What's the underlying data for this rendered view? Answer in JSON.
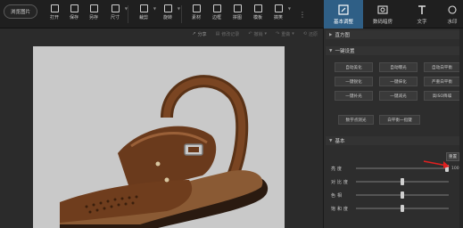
{
  "toolbar": {
    "browse_label": "浏览图片",
    "tools": [
      {
        "label": "打开",
        "icon": "open-icon"
      },
      {
        "label": "保存",
        "icon": "save-icon"
      },
      {
        "label": "另存",
        "icon": "save-as-icon"
      },
      {
        "label": "尺寸",
        "icon": "resize-icon"
      },
      {
        "label": "裁剪",
        "icon": "crop-icon"
      },
      {
        "label": "旋转",
        "icon": "rotate-icon"
      },
      {
        "label": "素材",
        "icon": "material-icon"
      },
      {
        "label": "边框",
        "icon": "border-icon"
      },
      {
        "label": "拼图",
        "icon": "collage-icon"
      },
      {
        "label": "模板",
        "icon": "template-icon"
      },
      {
        "label": "搞笑",
        "icon": "funny-icon"
      }
    ],
    "right_tabs": [
      {
        "label": "基本调整",
        "icon": "adjust-icon"
      },
      {
        "label": "数码暗房",
        "icon": "darkroom-icon"
      },
      {
        "label": "文字",
        "icon": "text-icon"
      },
      {
        "label": "水印",
        "icon": "watermark-icon"
      }
    ]
  },
  "canvas": {
    "sub_toolbar": [
      {
        "label": "分享",
        "icon": "share-icon",
        "dim": false
      },
      {
        "label": "修改记录",
        "icon": "history-icon",
        "dim": true
      },
      {
        "label": "撤销",
        "icon": "undo-icon",
        "dim": true
      },
      {
        "label": "重做",
        "icon": "redo-icon",
        "dim": true
      },
      {
        "label": "还原",
        "icon": "restore-icon",
        "dim": true
      }
    ]
  },
  "panel": {
    "section_histogram": "直方图",
    "section_oneclick": "一键设置",
    "oneclick_buttons": [
      "自动美化",
      "自动曝光",
      "自动白平衡",
      "一键锐化",
      "一键抹化",
      "严重白平衡",
      "一键补光",
      "一键减光",
      "高ISO降噪"
    ],
    "extra_buttons": [
      "数字点测光",
      "白平衡一指键"
    ],
    "section_basic": "基本",
    "reset_label": "重置",
    "sliders": [
      {
        "label": "亮度",
        "value": "100",
        "level": 0.98
      },
      {
        "label": "对比度",
        "value": "",
        "level": 0.5
      },
      {
        "label": "色相",
        "value": "",
        "level": 0.5
      },
      {
        "label": "饱和度",
        "value": "",
        "level": 0.5
      }
    ]
  },
  "colors": {
    "accent_tab": "#2f5f86",
    "annotation_arrow": "#e02020"
  }
}
